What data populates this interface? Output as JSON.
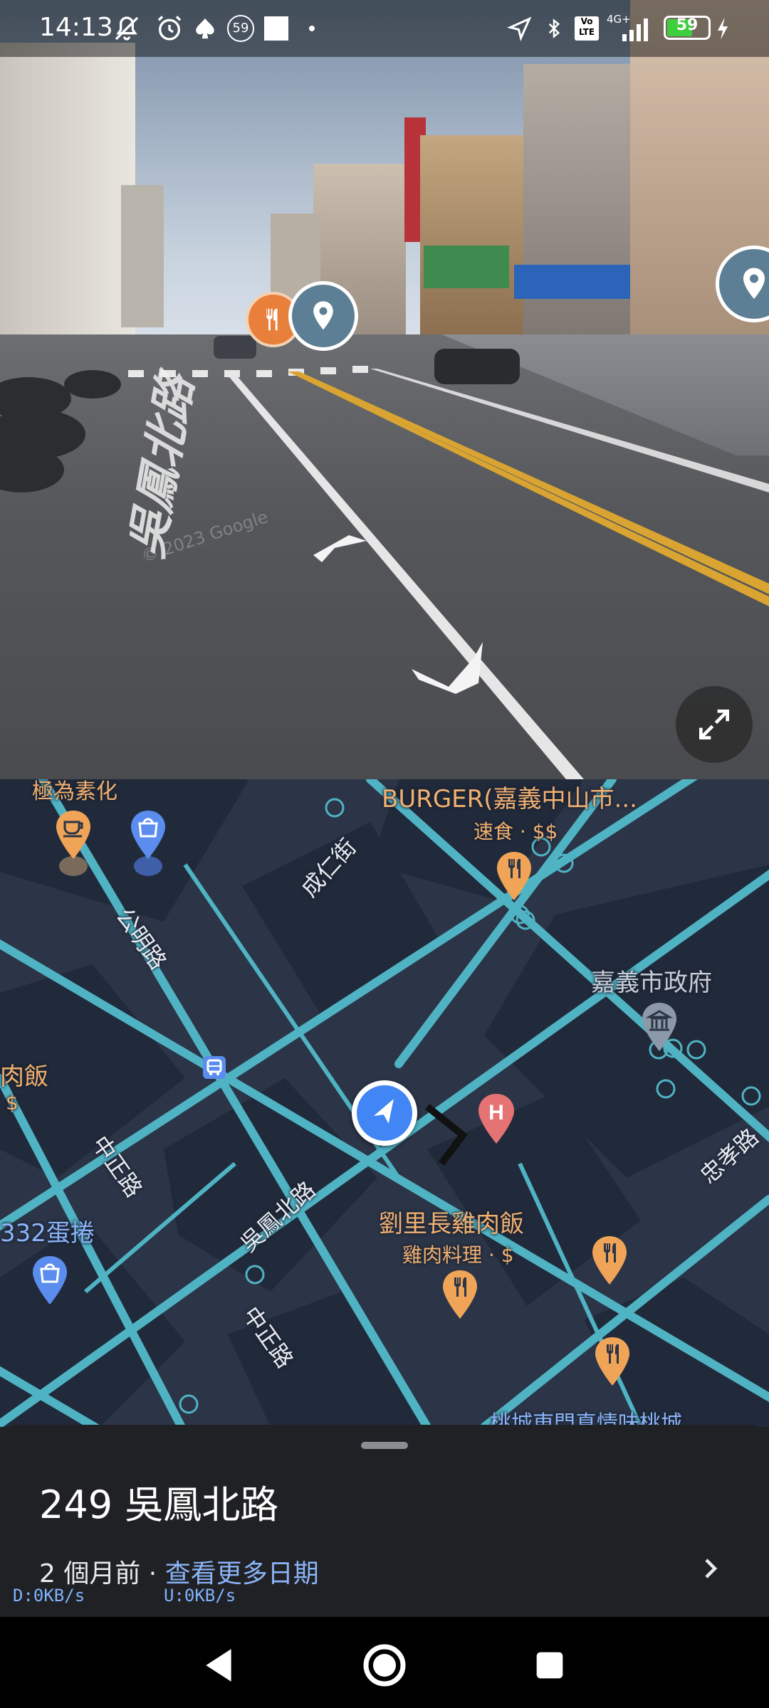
{
  "status_bar": {
    "time": "14:13",
    "notification_badge": "59",
    "network_label": "4G+",
    "volte_label": "Vo LTE",
    "battery_level": "59",
    "icons": [
      "mute-icon",
      "alarm-icon",
      "spade-icon",
      "badge-59-icon",
      "square-icon",
      "dot-icon",
      "location-arrow-icon",
      "bluetooth-icon",
      "volte-icon",
      "signal-icon",
      "battery-icon",
      "charging-icon"
    ]
  },
  "street_view": {
    "watermark": "© 2023 Google",
    "road_marking": "吳鳳北路"
  },
  "map": {
    "labels": {
      "burger_name": "BURGER(嘉義中山市...",
      "burger_category": "速食 · $$",
      "top_left_partial": "極為素化",
      "city_hall": "嘉義市政府",
      "left_rice": "肉飯",
      "left_rice_price": "$",
      "egg_roll": "332蛋捲",
      "chicken_rice": "劉里長雞肉飯",
      "chicken_rice_category": "雞肉料理 · $",
      "bottom_partial": "桃城東門真情味桃城"
    },
    "roads": {
      "chengren": "成仁街",
      "gongming": "公明路",
      "zhongzheng_1": "中正路",
      "wufeng_north": "吳鳳北路",
      "zhongzheng_2": "中正路",
      "zhongxiao": "忠孝路"
    },
    "colors": {
      "background": "#2b3547",
      "road": "#4fb3c4",
      "poi_food": "#f0a458",
      "poi_shopping": "#5b8def",
      "poi_hospital": "#e57373"
    }
  },
  "sheet": {
    "address": "249 吳鳳北路",
    "date_info": "2 個月前 · ",
    "more_dates_link": "查看更多日期",
    "download": "D:0KB/s",
    "upload": "U:0KB/s"
  }
}
